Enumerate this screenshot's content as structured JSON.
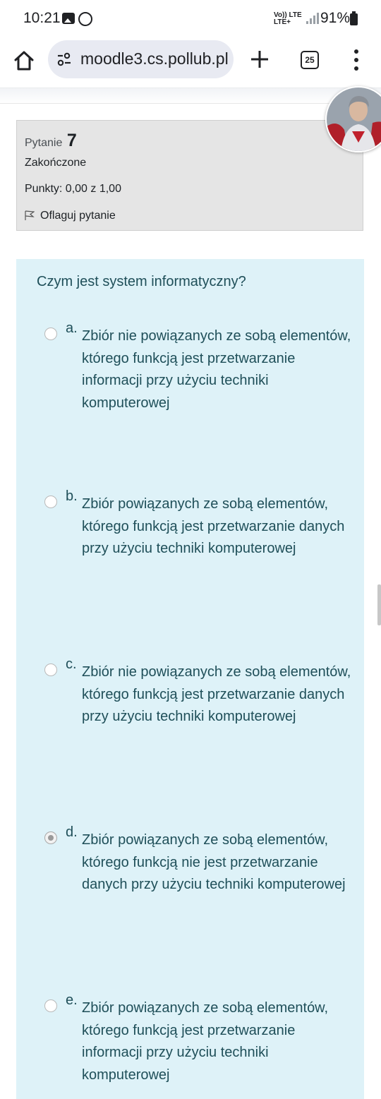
{
  "status_bar": {
    "time": "10:21",
    "network": "LTE+",
    "network_extra": "Vo)) LTE",
    "battery": "91%"
  },
  "browser": {
    "url": "moodle3.cs.pollub.pl",
    "tab_count": "25"
  },
  "question_info": {
    "label": "Pytanie",
    "number": "7",
    "state": "Zakończone",
    "grade": "Punkty: 0,00 z 1,00",
    "flag_label": "Oflaguj pytanie"
  },
  "question": {
    "text": "Czym jest system informatyczny?",
    "answers": [
      {
        "letter": "a.",
        "text": "Zbiór nie powiązanych ze sobą elementów, którego funkcją jest przetwarzanie informacji przy użyciu techniki komputerowej",
        "selected": false
      },
      {
        "letter": "b.",
        "text": "Zbiór  powiązanych ze sobą elementów, którego funkcją jest przetwarzanie danych przy użyciu techniki komputerowej",
        "selected": false
      },
      {
        "letter": "c.",
        "text": "Zbiór  nie powiązanych ze sobą elementów, którego funkcją jest przetwarzanie danych przy użyciu techniki komputerowej",
        "selected": false
      },
      {
        "letter": "d.",
        "text": "Zbiór powiązanych ze sobą elementów, którego funkcją nie jest przetwarzanie danych przy użyciu techniki komputerowej",
        "selected": true
      },
      {
        "letter": "e.",
        "text": "Zbiór powiązanych ze sobą elementów, którego funkcją jest przetwarzanie informacji przy użyciu techniki komputerowej",
        "selected": false
      }
    ]
  },
  "colors": {
    "question_bg": "#def2f8",
    "info_bg": "#e5e5e5",
    "question_text": "#1f4f59"
  }
}
